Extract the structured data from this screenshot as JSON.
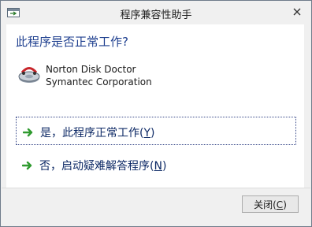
{
  "window": {
    "title": "程序兼容性助手"
  },
  "question": "此程序是否正常工作?",
  "program": {
    "name": "Norton Disk Doctor",
    "publisher": "Symantec Corporation"
  },
  "options": [
    {
      "label": "是，此程序正常工作(",
      "access_key": "Y",
      "suffix": ")"
    },
    {
      "label": "否，启动疑难解答程序(",
      "access_key": "N",
      "suffix": ")"
    }
  ],
  "footer": {
    "close_label": "关闭(",
    "close_access_key": "C",
    "close_suffix": ")"
  },
  "icons": {
    "app": "window-app-icon",
    "close": "close-x-icon",
    "program": "disk-doctor-icon",
    "option_arrow": "green-arrow-icon"
  },
  "colors": {
    "question": "#1e3f8f",
    "option_text": "#0e2a66",
    "arrow": "#2f9a2f"
  }
}
